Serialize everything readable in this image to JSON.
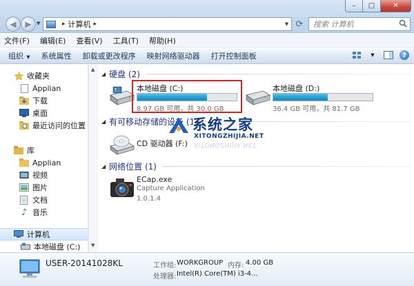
{
  "window": {
    "controls": {
      "min": "–",
      "max": "□",
      "close": "✕"
    }
  },
  "address": {
    "crumb": "计算机",
    "search_placeholder": "搜索 计算机"
  },
  "menu": [
    "文件(F)",
    "编辑(E)",
    "查看(V)",
    "工具(T)",
    "帮助(H)"
  ],
  "commands": {
    "organize": "组织",
    "system_properties": "系统属性",
    "uninstall": "卸载或更改程序",
    "map_drive": "映射网络驱动器",
    "control_panel": "打开控制面板"
  },
  "sidebar": {
    "favorites": "收藏夹",
    "fav_items": [
      "Applian",
      "下载",
      "桌面",
      "最近访问的位置"
    ],
    "library": "库",
    "lib_items": [
      "Applian",
      "视频",
      "图片",
      "文档",
      "音乐"
    ],
    "computer": "计算机",
    "local_disk": "本地磁盘 (C:)"
  },
  "main": {
    "hdd_group": "硬盘 (2)",
    "drives": [
      {
        "name": "本地磁盘 (C:)",
        "info": "8.97 GB 可用，共 30.0 GB",
        "used_fraction": 0.7
      },
      {
        "name": "本地磁盘 (D:)",
        "info": "36.4 GB 可用，共 81.7 GB",
        "used_fraction": 0.55
      }
    ],
    "removable_group": "有可移动存储的设备 (1)",
    "cd_drive": "CD 驱动器 (F:)",
    "network_group": "网络位置 (1)",
    "network_item": {
      "name": "ECap.exe",
      "desc": "Capture Application",
      "version": "1.0.1.4"
    }
  },
  "watermark": {
    "title": "系统之家",
    "url": "XITONGZHIJIA.NET"
  },
  "details": {
    "computer_name": "USER-20141028KL",
    "workgroup_label": "工作组:",
    "workgroup": "WORKGROUP",
    "memory_label": "内存:",
    "memory": "4.00 GB",
    "cpu_label": "处理器:",
    "cpu": "Intel(R) Core(TM) i3-4..."
  },
  "colors": {
    "group_title": "#1e3287",
    "bar_fill": "#26a0da",
    "highlight": "#e02020",
    "watermark": "#123d8a"
  }
}
